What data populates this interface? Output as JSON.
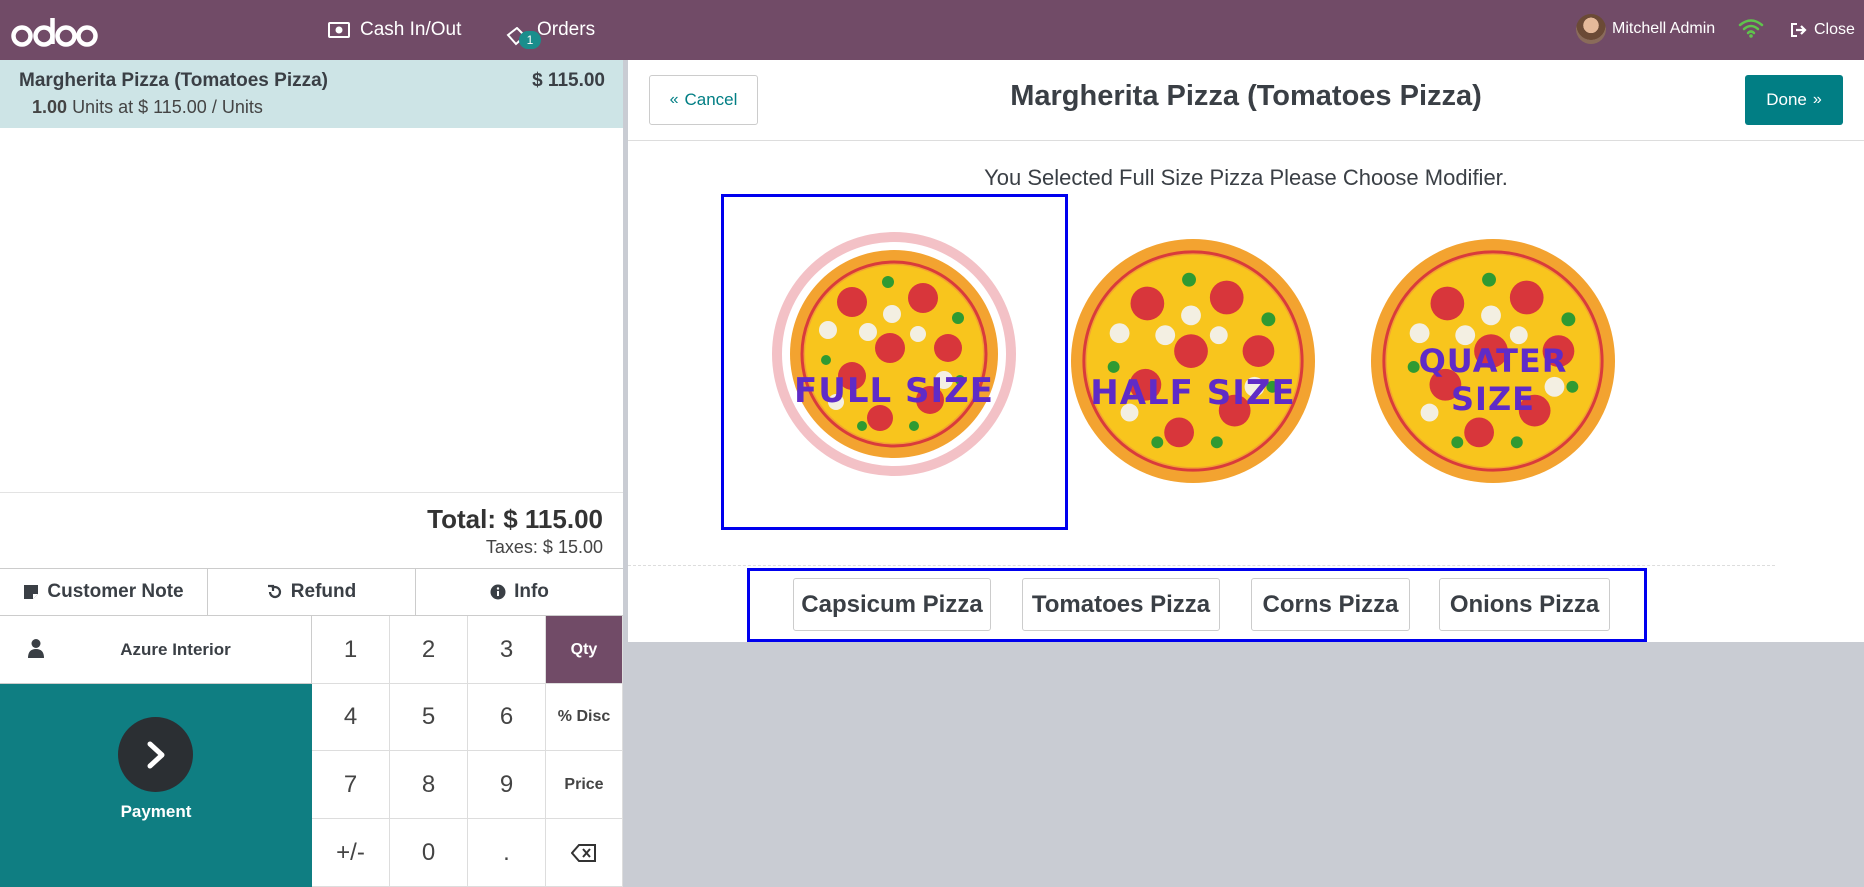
{
  "app": {
    "logo_text": "odoo"
  },
  "topbar": {
    "cash_label": "Cash In/Out",
    "orders_label": "Orders",
    "orders_badge": "1",
    "user_name": "Mitchell Admin",
    "close_label": "Close"
  },
  "order": {
    "line": {
      "product": "Margherita Pizza (Tomatoes Pizza)",
      "price": "$ 115.00",
      "qty": "1.00",
      "unit_info": "Units at $ 115.00 / Units"
    },
    "total": "Total: $ 115.00",
    "taxes": "Taxes: $ 15.00"
  },
  "controls": {
    "customer_note": "Customer Note",
    "refund": "Refund",
    "info": "Info"
  },
  "customer": {
    "name": "Azure Interior"
  },
  "payment": {
    "label": "Payment"
  },
  "numpad": {
    "keys": [
      "1",
      "2",
      "3",
      "Qty",
      "4",
      "5",
      "6",
      "% Disc",
      "7",
      "8",
      "9",
      "Price",
      "+/-",
      "0",
      ".",
      "⌫"
    ],
    "active_mode": "Qty"
  },
  "popup": {
    "cancel_label": "Cancel",
    "title": "Margherita Pizza (Tomatoes Pizza)",
    "done_label": "Done",
    "message": "You Selected Full Size Pizza Please Choose Modifier.",
    "sizes": [
      {
        "label": "FULL SIZE",
        "selected": true
      },
      {
        "label": "HALF SIZE",
        "selected": false
      },
      {
        "label": "QUATER SIZE",
        "selected": false
      }
    ],
    "modifiers": [
      "Capsicum Pizza",
      "Tomatoes Pizza",
      "Corns Pizza",
      "Onions Pizza"
    ]
  },
  "colors": {
    "brand": "#714b67",
    "accent": "#017e84",
    "payment_bg": "#0f7e82",
    "selection_outline": "#0000ee",
    "size_label": "#5f2bc7"
  }
}
